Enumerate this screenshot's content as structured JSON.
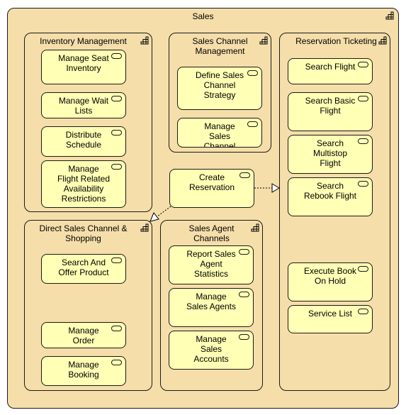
{
  "diagram": {
    "root": {
      "title": "Sales"
    },
    "groups": [
      {
        "id": "inventory",
        "title": "Inventory Management"
      },
      {
        "id": "sales_channel_mgmt",
        "title": "Sales Channel\nManagement"
      },
      {
        "id": "reservation_ticketing",
        "title": "Reservation Ticketing"
      },
      {
        "id": "direct_sales",
        "title": "Direct Sales Channel &\nShopping"
      },
      {
        "id": "sales_agent",
        "title": "Sales Agent\nChannels"
      }
    ],
    "services": {
      "manage_seat_inventory": "Manage Seat\nInventory",
      "manage_wait_lists": "Manage Wait\nLists",
      "distribute_schedule": "Distribute\nSchedule",
      "manage_flight_restrictions": "Manage\nFlight Related\nAvailability\nRestrictions",
      "define_sales_channel_strategy": "Define Sales\nChannel\nStrategy",
      "manage_sales_channel": "Manage\nSales\nChannel",
      "search_flight": "Search Flight",
      "search_basic_flight": "Search Basic\nFlight",
      "search_multistop_flight": "Search\nMultistop\nFlight",
      "search_rebook_flight": "Search\nRebook Flight",
      "execute_book_on_hold": "Execute Book\nOn Hold",
      "service_list": "Service List",
      "create_reservation": "Create\nReservation",
      "search_and_offer_product": "Search And\nOffer Product",
      "manage_order": "Manage\nOrder",
      "manage_booking": "Manage\nBooking",
      "report_sales_agent_statistics": "Report Sales\nAgent\nStatistics",
      "manage_sales_agents": "Manage\nSales Agents",
      "manage_sales_accounts": "Manage\nSales\nAccounts"
    },
    "relations": [
      {
        "from": "Create Reservation",
        "to": "Reservation Ticketing",
        "type": "realization"
      },
      {
        "from": "Create Reservation",
        "to": "Direct Sales Channel & Shopping",
        "type": "realization"
      }
    ],
    "colors": {
      "group_fill": "#f5deaa",
      "service_fill": "#ffffb5",
      "stroke": "#1a1a1a"
    }
  }
}
